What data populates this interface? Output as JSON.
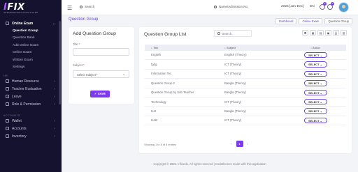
{
  "app": {
    "logo_main": "FIX",
    "logo_prefix": "I",
    "logo_tagline": "INTEGRATED EDUCATION SYSTEM"
  },
  "colors": {
    "accent": "#7c3aed",
    "sidebar_bg": "#14122e",
    "page_bg": "#f3f4f8"
  },
  "sidebar": {
    "active_parent": "Online Exam",
    "online_exam_items": [
      "Question Group",
      "Question Bank",
      "Add Online Exam",
      "Online Exam",
      "Written Exam",
      "Settings"
    ],
    "active_item": "Question Group",
    "hr_section": "HR",
    "hr_items": [
      "Human Resource",
      "Teacher Evaluation",
      "Leave",
      "Role & Permission"
    ],
    "accounts_section": "ACCOUNTS",
    "accounts_items": [
      "Wallet",
      "Accounts",
      "Inventory"
    ]
  },
  "topbar": {
    "search_label": "Search",
    "student_search_placeholder": "Name/Admission No",
    "session": "2025 [Jan-Dec]",
    "language": "EN",
    "badges": [
      "0",
      "0",
      "0"
    ]
  },
  "page": {
    "title": "Question Group",
    "breadcrumb": [
      "Dashboard",
      "Online Exam",
      "Question Group"
    ]
  },
  "add_form": {
    "title": "Add Question Group",
    "title_label": "Title",
    "subject_label": "Subject",
    "subject_placeholder": "Select Subject *",
    "save_label": "SAVE"
  },
  "list": {
    "title": "Question Group List",
    "search_placeholder": "Search...",
    "columns": [
      "Title",
      "Subject",
      "Action"
    ],
    "action_label": "SELECT",
    "rows": [
      {
        "title": "English",
        "subject": "English (Theory)"
      },
      {
        "title": "fgdg",
        "subject": "ICT (Theory)"
      },
      {
        "title": "Information Tec",
        "subject": "ICT (Theory)"
      },
      {
        "title": "Question Group 2",
        "subject": "Bangla (Theory)"
      },
      {
        "title": "Question Group by Sub Teacher",
        "subject": "Bangla (Theory)"
      },
      {
        "title": "Technology",
        "subject": "ICT (Theory)"
      },
      {
        "title": "test",
        "subject": "Bangla (Theory)"
      },
      {
        "title": "test2",
        "subject": "ICT (Theory)"
      }
    ],
    "showing_text": "Showing 1 to 8 of 8 entries",
    "current_page": "1",
    "prev": "‹",
    "next": "›"
  },
  "footer": "Copyright © 2025. Infixedu. All rights reserved | Codethemes made with this application"
}
